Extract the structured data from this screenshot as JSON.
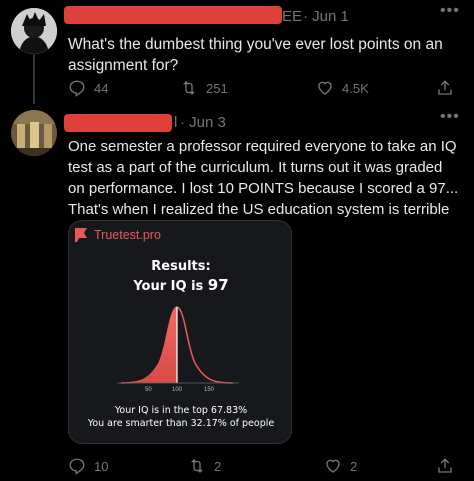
{
  "tweet1": {
    "handle_suffix": "EE",
    "date": "· Jun 1",
    "text": "What's the dumbest thing you've ever lost points on an assignment for?",
    "replies": "44",
    "retweets": "251",
    "likes": "4.5K"
  },
  "tweet2": {
    "handle_suffix": "l",
    "date": "· Jun 3",
    "text": "One semester a professor required everyone to take an IQ test as a part of the curriculum. It turns out it was graded on performance. I lost 10 POINTS because I scored a 97... That's when I realized the US education system is terrible",
    "replies": "10",
    "retweets": "2",
    "likes": "2"
  },
  "card": {
    "logo": "Truetest.pro",
    "results_label": "Results:",
    "iq_prefix": "Your IQ is ",
    "iq_value": "97",
    "ticks": [
      "50",
      "100",
      "150"
    ],
    "top_line": "Your IQ is in the top 67.83%",
    "smarter_line": "You are smarter than 32.17% of people"
  },
  "colors": {
    "background": "#000000",
    "text": "#e7e9ea",
    "muted": "#71767b",
    "redaction": "#e0403a",
    "accent": "#e85a5a"
  },
  "icons": [
    "more-icon",
    "reply-icon",
    "retweet-icon",
    "like-icon",
    "share-icon"
  ]
}
